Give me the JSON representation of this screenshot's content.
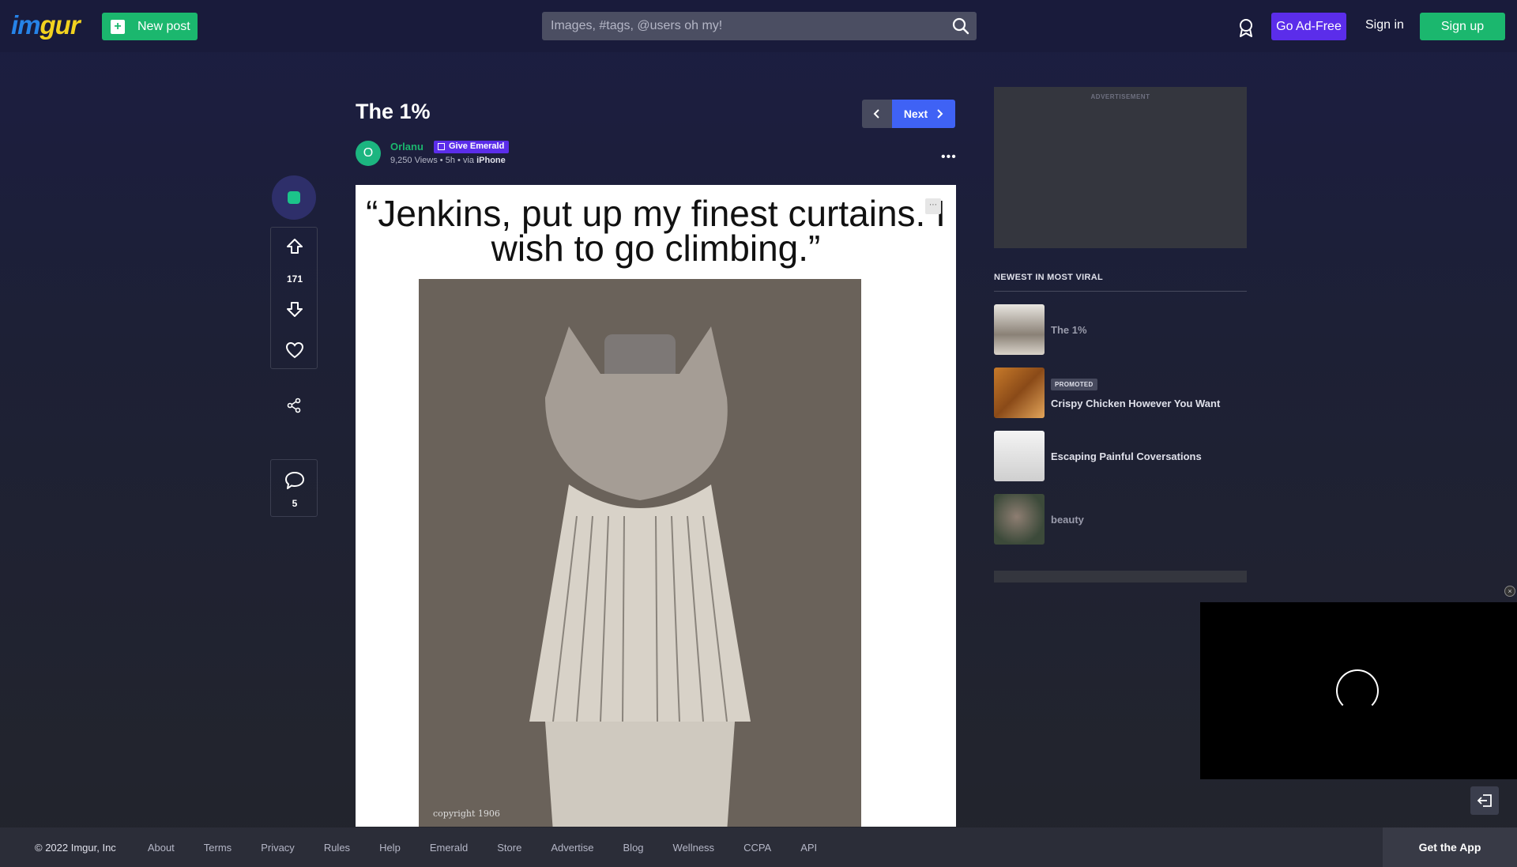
{
  "header": {
    "logo": "imgur",
    "new_post": "New post",
    "search_placeholder": "Images, #tags, @users oh my!",
    "go_ad_free": "Go Ad-Free",
    "sign_in": "Sign in",
    "sign_up": "Sign up"
  },
  "post": {
    "title": "The 1%",
    "next_label": "Next",
    "author": "Orlanu",
    "avatar_letter": "O",
    "give_emerald": "Give Emerald",
    "views": "9,250 Views",
    "age": "5h",
    "via": "via",
    "via_source": "iPhone",
    "image_caption": "“Jenkins, put up my finest curtains. I wish to go climbing.”",
    "votes": "171",
    "comments": "5"
  },
  "sidebar": {
    "ad_label": "ADVERTISEMENT",
    "heading": "NEWEST IN MOST VIRAL",
    "items": [
      {
        "title": "The 1%"
      },
      {
        "badge": "PROMOTED",
        "title": "Crispy Chicken However You Want"
      },
      {
        "title": "Escaping Painful Coversations"
      },
      {
        "title": "beauty"
      }
    ]
  },
  "footer": {
    "copyright": "© 2022 Imgur, Inc",
    "links": [
      "About",
      "Terms",
      "Privacy",
      "Rules",
      "Help",
      "Emerald",
      "Store",
      "Advertise",
      "Blog",
      "Wellness",
      "CCPA",
      "API"
    ],
    "get_app": "Get the App"
  },
  "colors": {
    "brand_green": "#1bb76e",
    "brand_purple": "#5b2dea",
    "next_blue": "#3f62f5",
    "background": "#1b1d42"
  }
}
